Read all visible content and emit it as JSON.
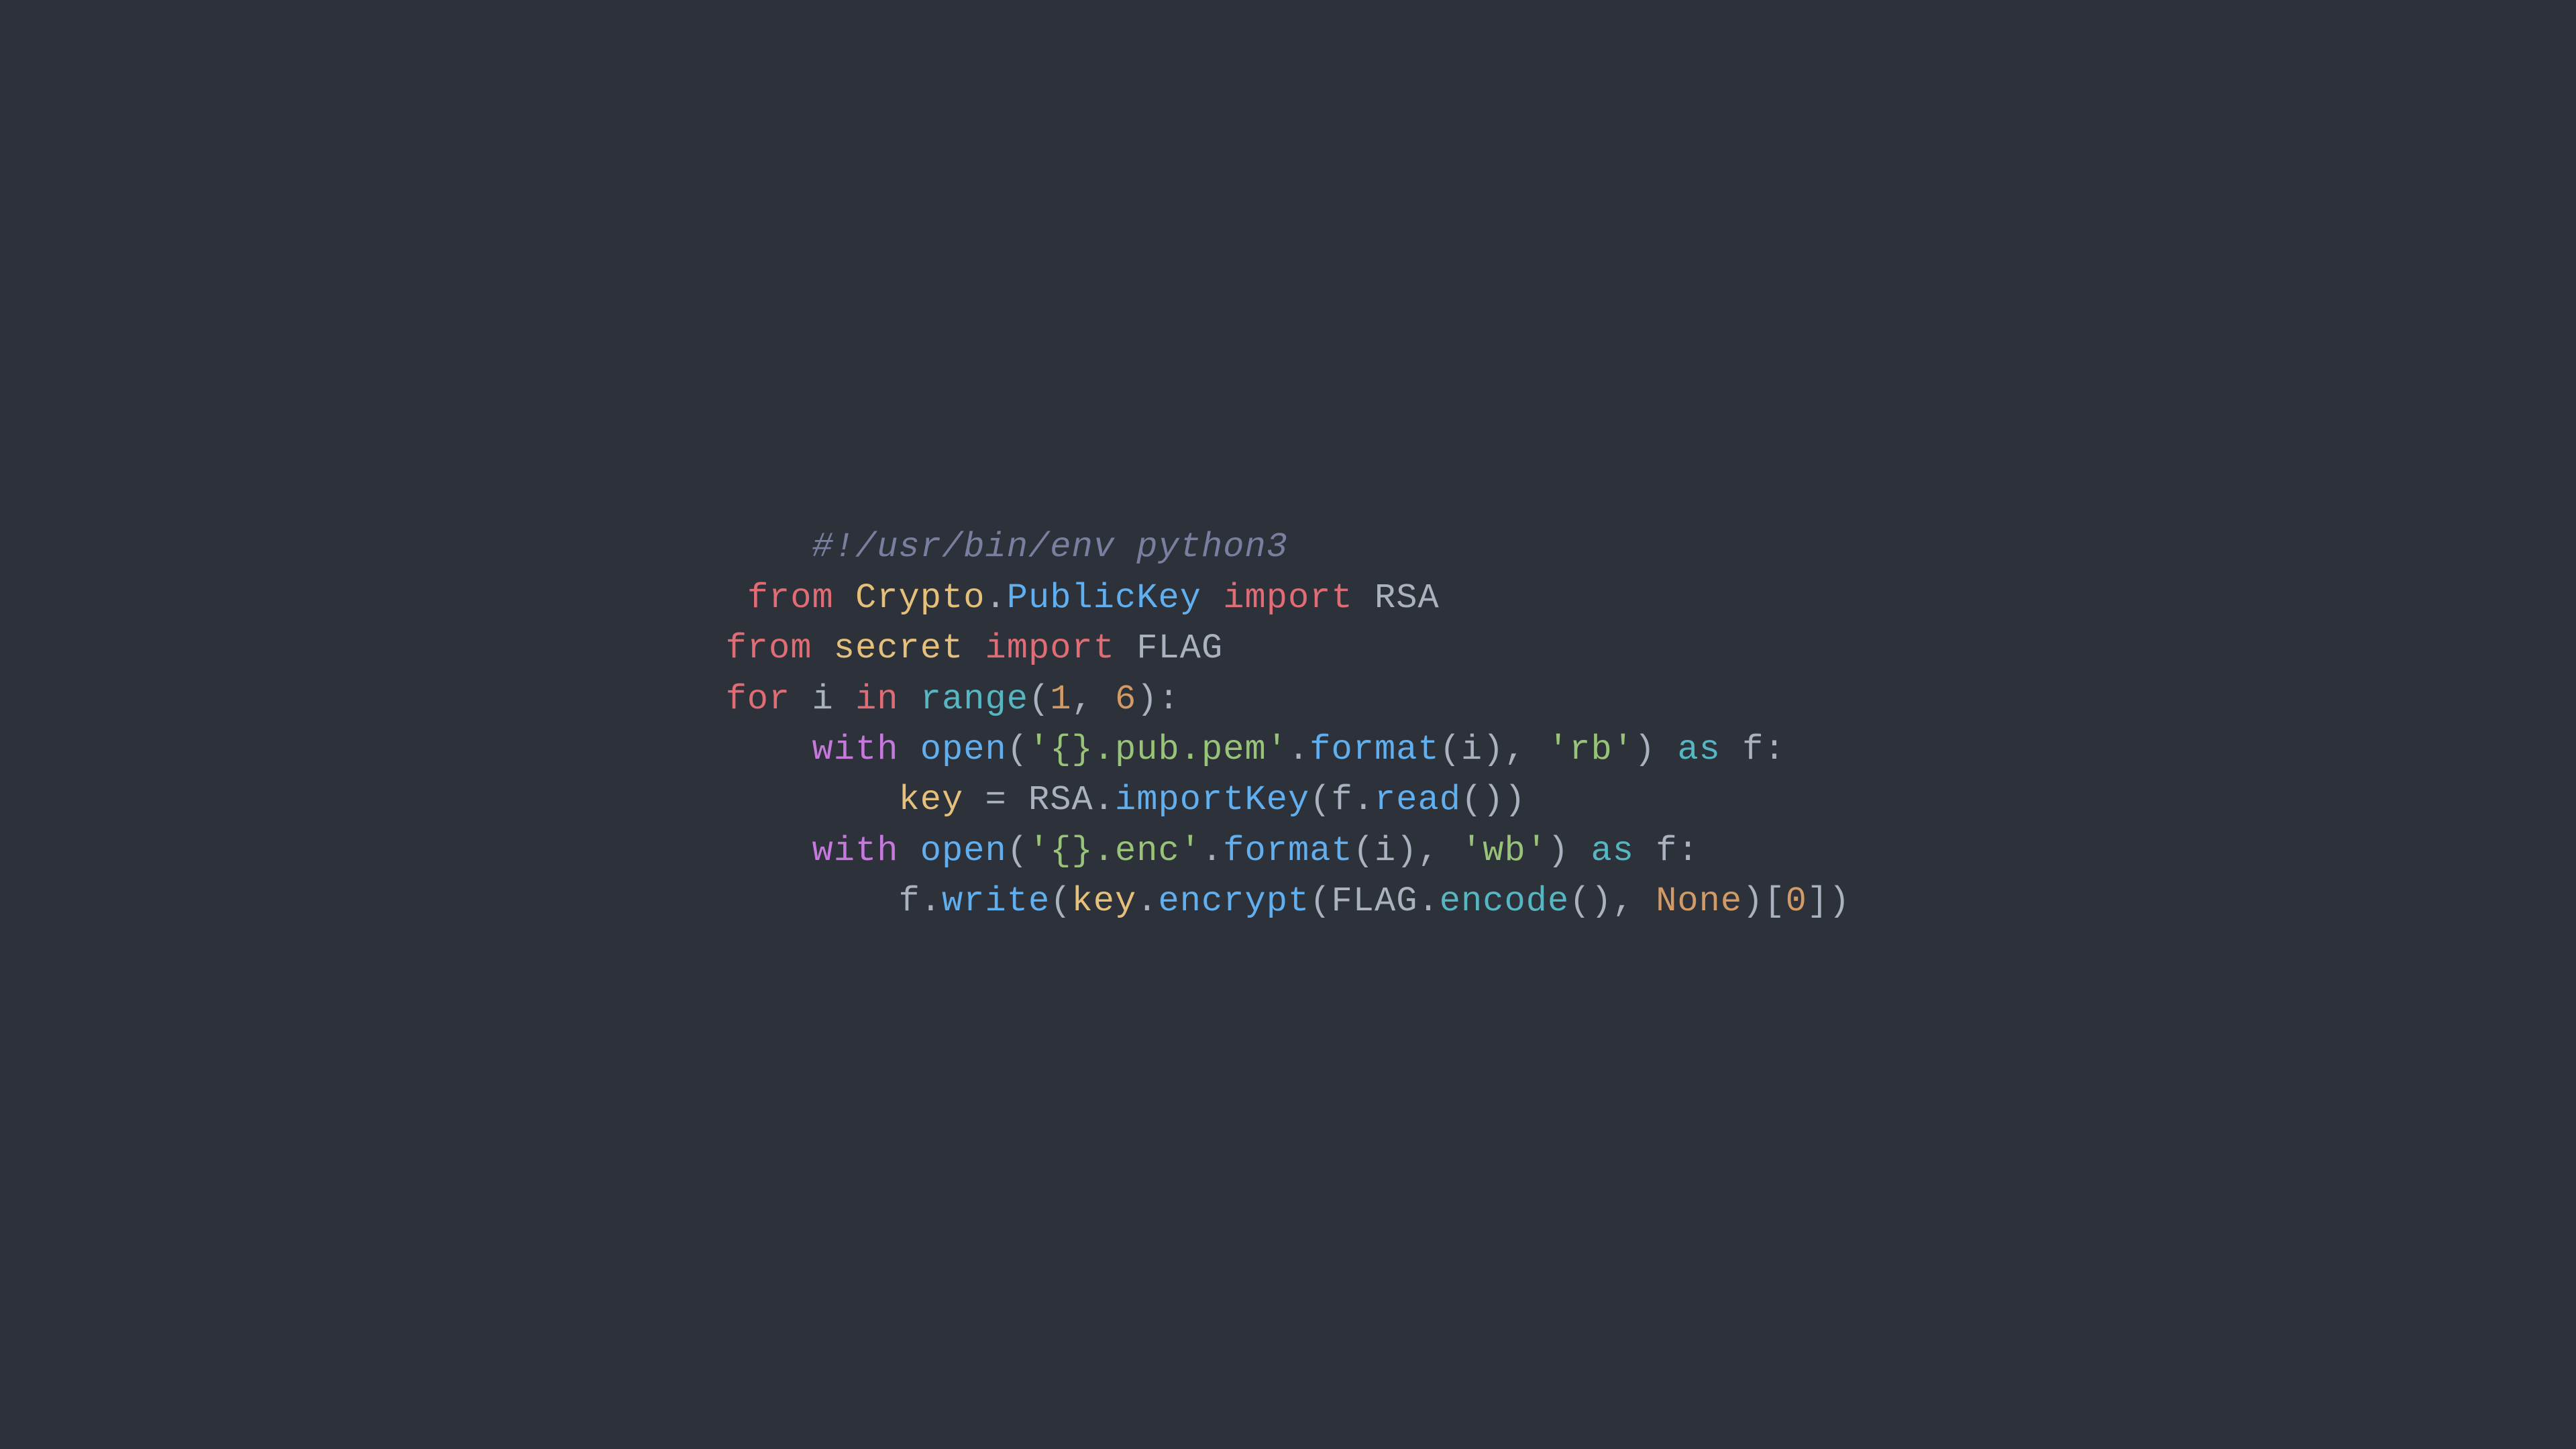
{
  "background": "#2d3139",
  "code": {
    "lines": [
      {
        "id": "line-shebang",
        "indent": "    ",
        "tokens": [
          {
            "text": "#!/usr/bin/env python3",
            "class": "c-comment"
          }
        ]
      },
      {
        "id": "line-import1",
        "indent": " ",
        "tokens": [
          {
            "text": "from",
            "class": "c-keyword"
          },
          {
            "text": " ",
            "class": "c-plain"
          },
          {
            "text": "Crypto",
            "class": "c-module"
          },
          {
            "text": ".",
            "class": "c-plain"
          },
          {
            "text": "PublicKey",
            "class": "c-class"
          },
          {
            "text": " ",
            "class": "c-plain"
          },
          {
            "text": "import",
            "class": "c-keyword"
          },
          {
            "text": " RSA",
            "class": "c-rsa"
          }
        ]
      },
      {
        "id": "line-import2",
        "indent": "",
        "tokens": [
          {
            "text": "from",
            "class": "c-keyword"
          },
          {
            "text": " ",
            "class": "c-plain"
          },
          {
            "text": "secret",
            "class": "c-module"
          },
          {
            "text": " ",
            "class": "c-plain"
          },
          {
            "text": "import",
            "class": "c-keyword"
          },
          {
            "text": " FLAG",
            "class": "c-flag"
          }
        ]
      },
      {
        "id": "line-blank1",
        "indent": "",
        "tokens": []
      },
      {
        "id": "line-blank2",
        "indent": "",
        "tokens": []
      },
      {
        "id": "line-for",
        "indent": "",
        "tokens": [
          {
            "text": "for",
            "class": "c-keyword"
          },
          {
            "text": " i ",
            "class": "c-var"
          },
          {
            "text": "in",
            "class": "c-keyword"
          },
          {
            "text": " ",
            "class": "c-plain"
          },
          {
            "text": "range",
            "class": "c-builtin"
          },
          {
            "text": "(",
            "class": "c-plain"
          },
          {
            "text": "1",
            "class": "c-number"
          },
          {
            "text": ", ",
            "class": "c-plain"
          },
          {
            "text": "6",
            "class": "c-number"
          },
          {
            "text": "):",
            "class": "c-plain"
          }
        ]
      },
      {
        "id": "line-with1",
        "indent": "    ",
        "tokens": [
          {
            "text": "with",
            "class": "c-with"
          },
          {
            "text": " ",
            "class": "c-plain"
          },
          {
            "text": "open",
            "class": "c-function"
          },
          {
            "text": "(",
            "class": "c-plain"
          },
          {
            "text": "'{}.pub.pem'",
            "class": "c-string"
          },
          {
            "text": ".",
            "class": "c-plain"
          },
          {
            "text": "format",
            "class": "c-format-fn"
          },
          {
            "text": "(",
            "class": "c-plain"
          },
          {
            "text": "i",
            "class": "c-var"
          },
          {
            "text": "), ",
            "class": "c-plain"
          },
          {
            "text": "'rb'",
            "class": "c-string"
          },
          {
            "text": ") ",
            "class": "c-plain"
          },
          {
            "text": "as",
            "class": "c-as"
          },
          {
            "text": " f:",
            "class": "c-var"
          }
        ]
      },
      {
        "id": "line-key",
        "indent": "        ",
        "tokens": [
          {
            "text": "key",
            "class": "c-key"
          },
          {
            "text": " = ",
            "class": "c-plain"
          },
          {
            "text": "RSA",
            "class": "c-rsa"
          },
          {
            "text": ".",
            "class": "c-plain"
          },
          {
            "text": "importKey",
            "class": "c-importkey"
          },
          {
            "text": "(",
            "class": "c-plain"
          },
          {
            "text": "f",
            "class": "c-var"
          },
          {
            "text": ".",
            "class": "c-plain"
          },
          {
            "text": "read",
            "class": "c-function"
          },
          {
            "text": "())",
            "class": "c-plain"
          }
        ]
      },
      {
        "id": "line-with2",
        "indent": "    ",
        "tokens": [
          {
            "text": "with",
            "class": "c-with"
          },
          {
            "text": " ",
            "class": "c-plain"
          },
          {
            "text": "open",
            "class": "c-function"
          },
          {
            "text": "(",
            "class": "c-plain"
          },
          {
            "text": "'{}.enc'",
            "class": "c-string"
          },
          {
            "text": ".",
            "class": "c-plain"
          },
          {
            "text": "format",
            "class": "c-format-fn"
          },
          {
            "text": "(",
            "class": "c-plain"
          },
          {
            "text": "i",
            "class": "c-var"
          },
          {
            "text": "), ",
            "class": "c-plain"
          },
          {
            "text": "'wb'",
            "class": "c-string"
          },
          {
            "text": ") ",
            "class": "c-plain"
          },
          {
            "text": "as",
            "class": "c-as"
          },
          {
            "text": " f:",
            "class": "c-var"
          }
        ]
      },
      {
        "id": "line-write",
        "indent": "        ",
        "tokens": [
          {
            "text": "f",
            "class": "c-var"
          },
          {
            "text": ".",
            "class": "c-plain"
          },
          {
            "text": "write",
            "class": "c-function"
          },
          {
            "text": "(",
            "class": "c-plain"
          },
          {
            "text": "key",
            "class": "c-key"
          },
          {
            "text": ".",
            "class": "c-plain"
          },
          {
            "text": "encrypt",
            "class": "c-function"
          },
          {
            "text": "(",
            "class": "c-plain"
          },
          {
            "text": "FLAG",
            "class": "c-flag"
          },
          {
            "text": ".",
            "class": "c-plain"
          },
          {
            "text": "encode",
            "class": "c-flag-enc"
          },
          {
            "text": "(), ",
            "class": "c-plain"
          },
          {
            "text": "None",
            "class": "c-none"
          },
          {
            "text": ")[",
            "class": "c-plain"
          },
          {
            "text": "0",
            "class": "c-number"
          },
          {
            "text": "])",
            "class": "c-plain"
          }
        ]
      }
    ]
  }
}
